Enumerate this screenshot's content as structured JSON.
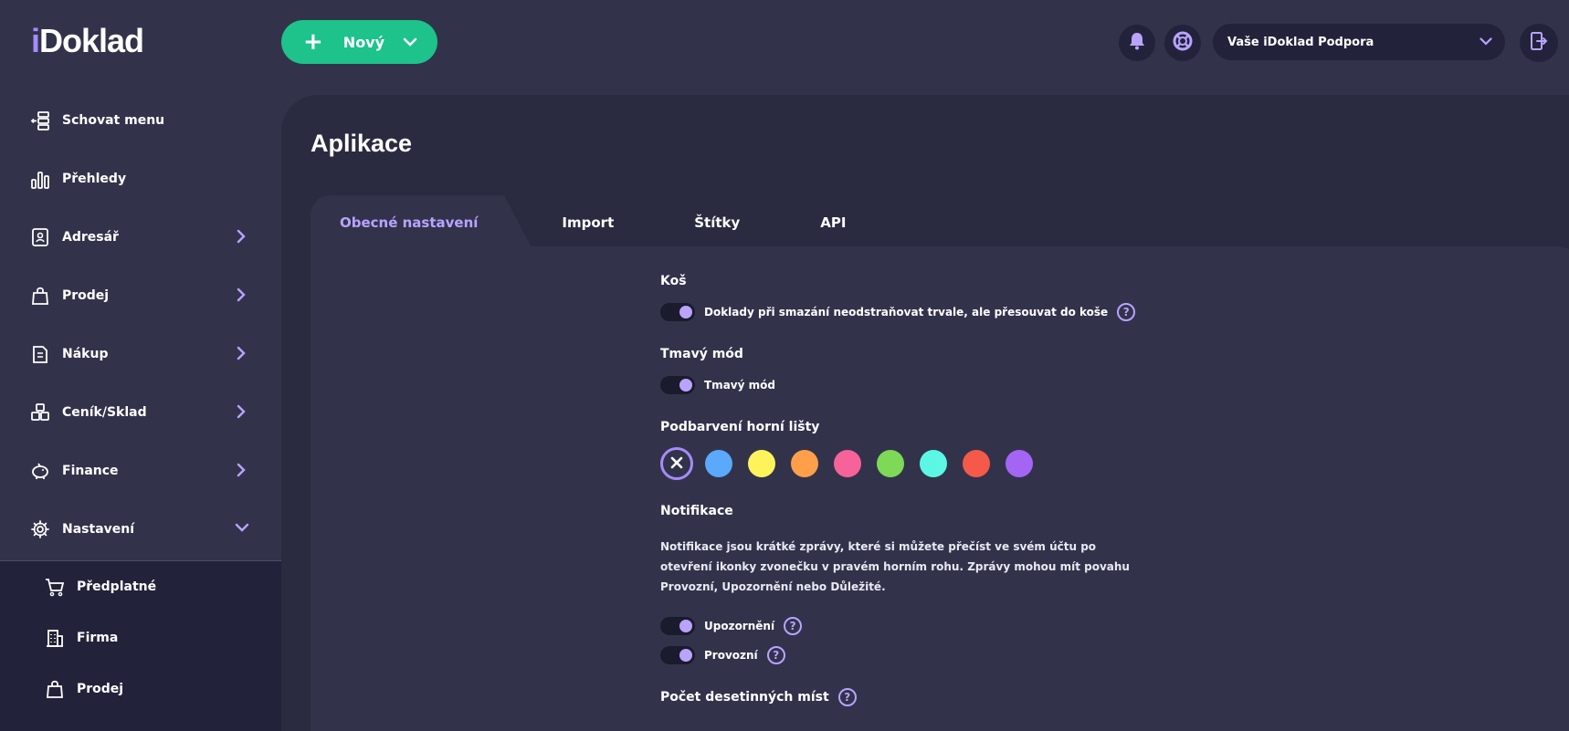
{
  "logo": {
    "text_i": "i",
    "text_rest": "Doklad"
  },
  "header": {
    "new_button_label": "Nový",
    "account_name": "Vaše iDoklad Podpora"
  },
  "sidebar": {
    "items": [
      {
        "label": "Schovat menu",
        "icon": "hide-menu-icon",
        "has_arrow": false
      },
      {
        "label": "Přehledy",
        "icon": "bar-chart-icon",
        "has_arrow": false
      },
      {
        "label": "Adresář",
        "icon": "address-book-icon",
        "has_arrow": true
      },
      {
        "label": "Prodej",
        "icon": "shopping-bag-icon",
        "has_arrow": true
      },
      {
        "label": "Nákup",
        "icon": "purchase-icon",
        "has_arrow": true
      },
      {
        "label": "Ceník/Sklad",
        "icon": "warehouse-icon",
        "has_arrow": true
      },
      {
        "label": "Finance",
        "icon": "piggy-bank-icon",
        "has_arrow": true
      },
      {
        "label": "Nastavení",
        "icon": "gear-icon",
        "has_arrow": true,
        "expanded": true
      }
    ],
    "sub_items": [
      {
        "label": "Předplatné",
        "icon": "cart-icon"
      },
      {
        "label": "Firma",
        "icon": "building-icon"
      },
      {
        "label": "Prodej",
        "icon": "shopping-bag-icon"
      }
    ]
  },
  "page": {
    "title": "Aplikace",
    "tabs": [
      {
        "label": "Obecné nastavení",
        "active": true
      },
      {
        "label": "Import",
        "active": false
      },
      {
        "label": "Štítky",
        "active": false
      },
      {
        "label": "API",
        "active": false
      }
    ]
  },
  "settings": {
    "trash": {
      "title": "Koš",
      "toggle_label": "Doklady při smazání neodstraňovat trvale, ale přesouvat do koše",
      "enabled": true
    },
    "dark_mode": {
      "title": "Tmavý mód",
      "toggle_label": "Tmavý mód",
      "enabled": true
    },
    "header_color": {
      "title": "Podbarvení horní lišty",
      "colors": [
        "#5aa9fa",
        "#fff35c",
        "#ff9f4a",
        "#f7629a",
        "#7ed957",
        "#5cf7e4",
        "#f5594a",
        "#a465f5"
      ],
      "selected": "none"
    },
    "notifications": {
      "title": "Notifikace",
      "description": "Notifikace jsou krátké zprávy, které si můžete přečíst ve svém účtu po otevření ikonky zvonečku v pravém horním rohu. Zprávy mohou mít povahu Provozní, Upozornění nebo Důležité.",
      "items": [
        {
          "label": "Upozornění",
          "enabled": true
        },
        {
          "label": "Provozní",
          "enabled": true
        }
      ]
    },
    "decimals": {
      "title": "Počet desetinných míst"
    }
  },
  "help_glyph": "?",
  "colors": {
    "accent": "#b9a3ff",
    "brand_green": "#1ec28b",
    "bg": "#32334b",
    "panel": "#2a2b40"
  }
}
